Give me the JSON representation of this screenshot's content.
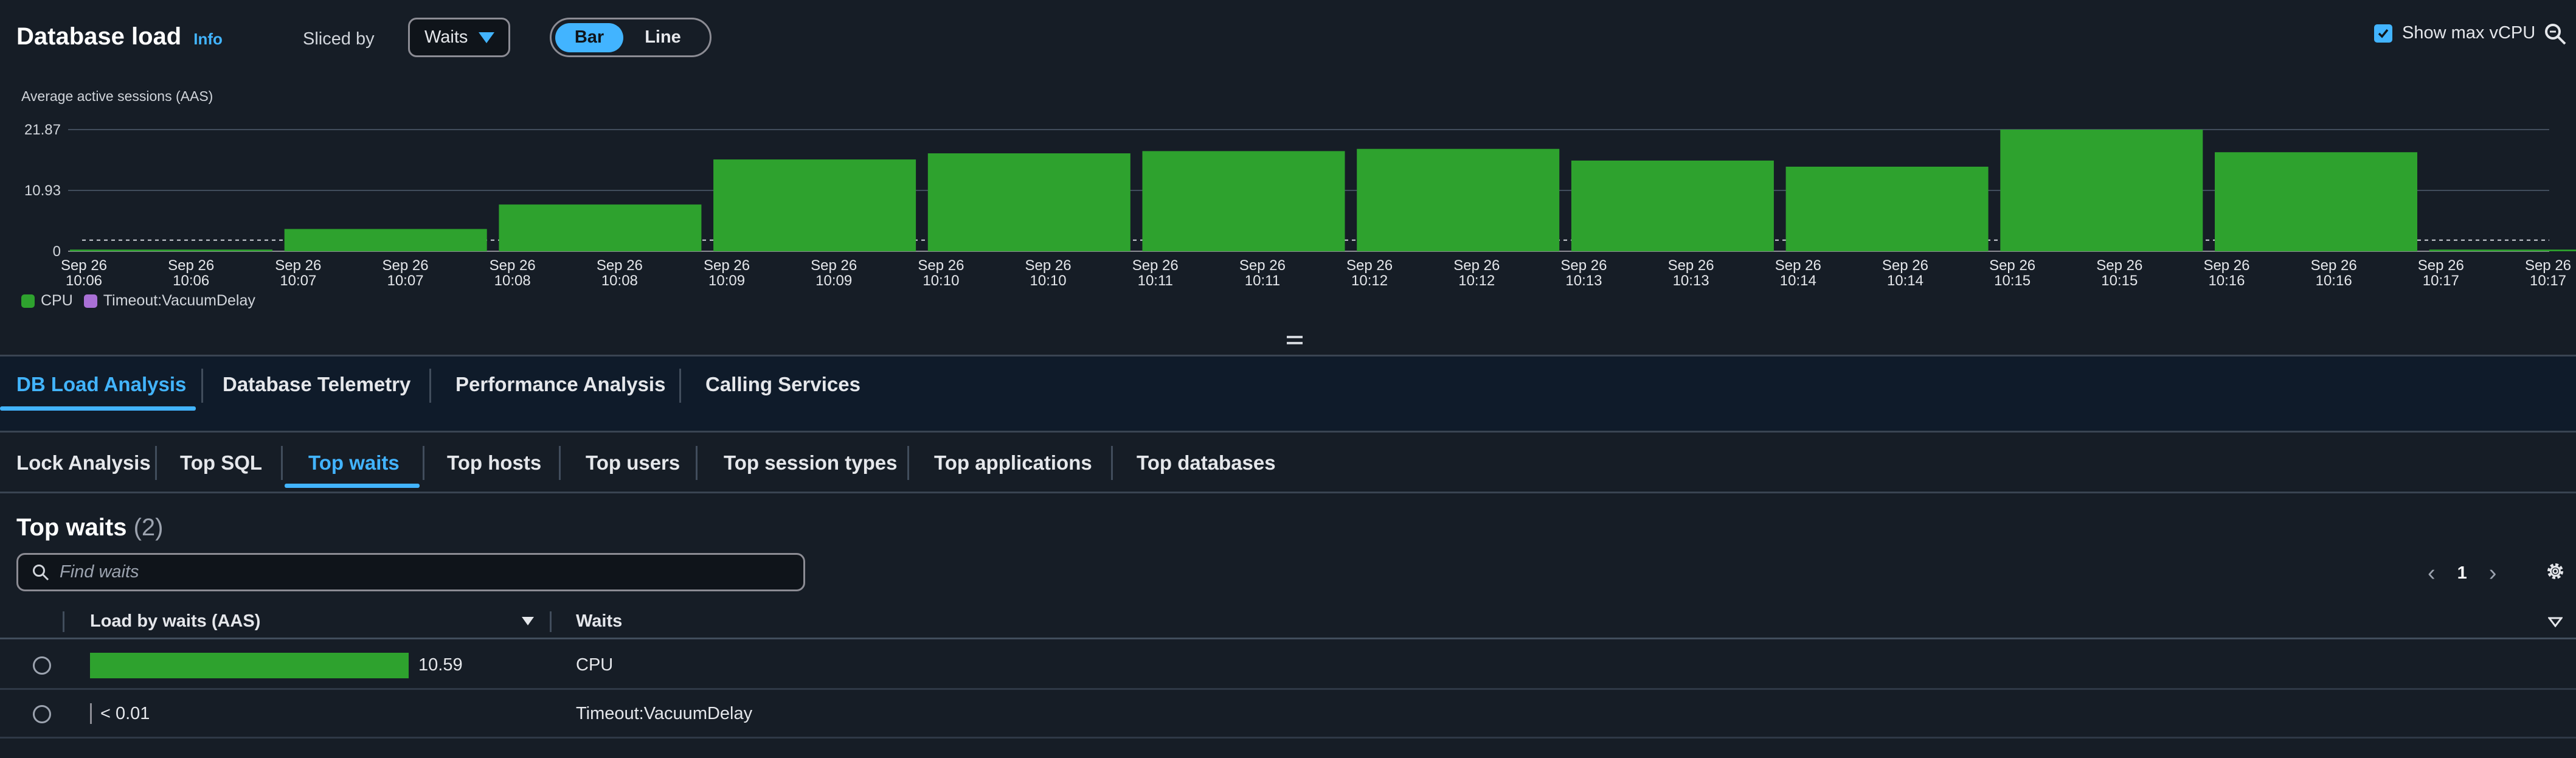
{
  "header": {
    "title": "Database load",
    "info": "Info",
    "sliced_by_label": "Sliced by",
    "sliced_by_value": "Waits",
    "view_toggle": {
      "bar": "Bar",
      "line": "Line",
      "selected": "Bar"
    },
    "show_max_vcpu_label": "Show max vCPU",
    "show_max_vcpu_checked": true
  },
  "chart_data": {
    "type": "bar",
    "ylabel": "Average active sessions (AAS)",
    "y_ticks": [
      "0",
      "10.93",
      "21.87"
    ],
    "ylim": [
      0,
      21.87
    ],
    "x_ticks": [
      "Sep 26 10:06",
      "Sep 26 10:06",
      "Sep 26 10:07",
      "Sep 26 10:07",
      "Sep 26 10:08",
      "Sep 26 10:08",
      "Sep 26 10:09",
      "Sep 26 10:09",
      "Sep 26 10:10",
      "Sep 26 10:10",
      "Sep 26 10:11",
      "Sep 26 10:11",
      "Sep 26 10:12",
      "Sep 26 10:12",
      "Sep 26 10:13",
      "Sep 26 10:13",
      "Sep 26 10:14",
      "Sep 26 10:14",
      "Sep 26 10:15",
      "Sep 26 10:15",
      "Sep 26 10:16",
      "Sep 26 10:16",
      "Sep 26 10:17",
      "Sep 26 10:17"
    ],
    "series": [
      {
        "name": "CPU",
        "color": "#2ea22e",
        "values": [
          0.3,
          4.0,
          8.4,
          16.5,
          17.6,
          18.0,
          18.4,
          16.3,
          15.2,
          21.87,
          17.8,
          0.3
        ]
      },
      {
        "name": "Timeout:VacuumDelay",
        "color": "#a970d6",
        "values": [
          0,
          0,
          0,
          0,
          0,
          0,
          0,
          0,
          0,
          0,
          0,
          0
        ]
      }
    ],
    "max_vcpu": 2,
    "grid": true,
    "legend": "bottom-left"
  },
  "main_tabs": [
    "DB Load Analysis",
    "Database Telemetry",
    "Performance Analysis",
    "Calling Services"
  ],
  "sub_tabs": [
    "Lock Analysis",
    "Top SQL",
    "Top waits",
    "Top hosts",
    "Top users",
    "Top session types",
    "Top applications",
    "Top databases"
  ],
  "top_waits": {
    "title": "Top waits",
    "count": "(2)",
    "search_placeholder": "Find waits",
    "page": "1",
    "columns": {
      "load": "Load by waits (AAS)",
      "waits": "Waits"
    },
    "rows": [
      {
        "load": "10.59",
        "wait": "CPU",
        "bar_fraction": 1.0
      },
      {
        "load": "< 0.01",
        "wait": "Timeout:VacuumDelay",
        "bar_fraction": 0
      }
    ]
  }
}
